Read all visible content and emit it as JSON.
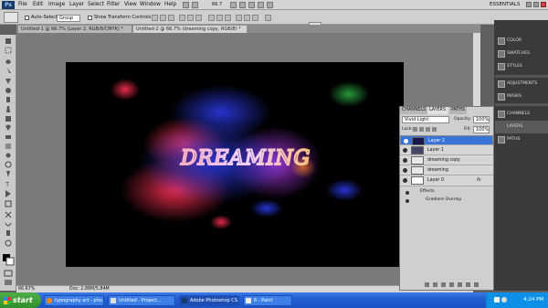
{
  "menubar": {
    "logo": "Ps",
    "items": [
      "File",
      "Edit",
      "Image",
      "Layer",
      "Select",
      "Filter",
      "View",
      "Window",
      "Help"
    ],
    "zoom": "66.7",
    "workspace": "ESSENTIALS"
  },
  "options": {
    "auto_select_label": "Auto-Select:",
    "auto_select_value": "Group",
    "transform_label": "Show Transform Controls"
  },
  "tabs": [
    {
      "label": "Untitled-1 @ 66.7% (Layer 2, RGB/8/CMYK) *"
    },
    {
      "label": "Untitled-2 @ 66.7% (dreaming copy, RGB/8) *"
    }
  ],
  "canvas": {
    "text": "DREAMING"
  },
  "status": {
    "zoom": "66.67%",
    "doc": "Doc: 2.88M/5.84M"
  },
  "layers_panel": {
    "tabs": [
      "CHANNELS",
      "LAYERS",
      "PATHS"
    ],
    "blend_mode": "Vivid Light",
    "opacity_label": "Opacity:",
    "opacity": "100%",
    "lock_label": "Lock:",
    "fill_label": "Fill:",
    "fill": "100%",
    "layers": [
      {
        "name": "Layer 2",
        "selected": true
      },
      {
        "name": "Layer 1",
        "selected": false
      },
      {
        "name": "dreaming copy",
        "selected": false
      },
      {
        "name": "dreaming",
        "selected": false
      },
      {
        "name": "Layer 0",
        "selected": false,
        "fx": "fx"
      }
    ],
    "effects_label": "Effects",
    "effect": "Gradient Overlay"
  },
  "dock": {
    "items": [
      "COLOR",
      "SWATCHES",
      "STYLES",
      "ADJUSTMENTS",
      "MASKS",
      "CHANNELS",
      "LAYERS",
      "PATHS"
    ]
  },
  "taskbar": {
    "start": "start",
    "tasks": [
      "typography art - pho...",
      "Untitled - Project...",
      "Adobe Photoshop CS...",
      "6 - Paint"
    ],
    "time": "4:24 PM"
  },
  "colors": {
    "selection": "#3a73d8",
    "taskbar": "#245ed1",
    "start": "#2f8f2b"
  }
}
